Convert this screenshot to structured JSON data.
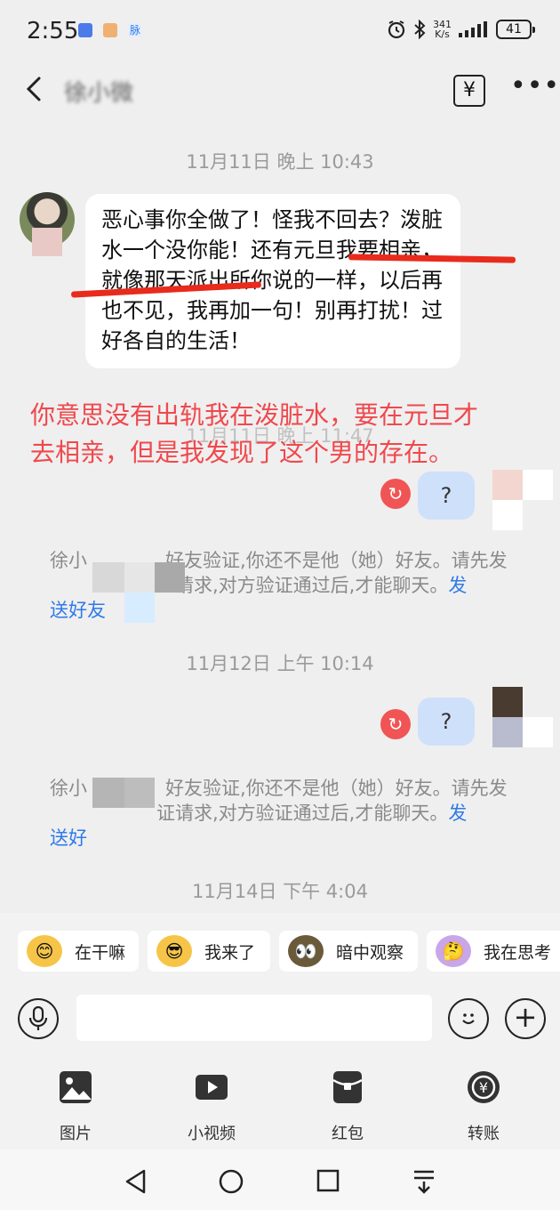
{
  "status_bar": {
    "time": "2:55",
    "net_speed_value": "341",
    "net_speed_unit": "K/s",
    "battery": "41"
  },
  "header": {
    "contact_name": "徐小微",
    "transfer_icon": "yuan-transfer-icon",
    "more_icon": "more-icon"
  },
  "chat": {
    "ts1": "11月11日 晚上 10:43",
    "incoming_message": "恶心事你全做了！怪我不回去？泼脏水一个没你能！还有元旦我要相亲，就像那天派出所你说的一样，以后再也不见，我再加一句！别再打扰！过好各自的生活！",
    "annotation": "你意思没有出轨我在泼脏水，要在元旦才去相亲，但是我发现了这个男的存在。",
    "ts2": "11月11日 晚上 11:47",
    "out1": "?",
    "sys1_prefix": "徐小",
    "sys1_text": "好友验证,你还不是他（她）好友。请先发",
    "sys1_mid": "证请求,对方验证通过后,才能聊天。",
    "sys1_link_a": "发",
    "sys1_link_b": "送好友",
    "ts3": "11月12日 上午 10:14",
    "out2": "?",
    "sys2_prefix": "徐小",
    "sys2_text": "好友验证,你还不是他（她）好友。请先发",
    "sys2_mid": "证请求,对方验证通过后,才能聊天。",
    "sys2_link_a": "发",
    "sys2_link_b": "送好",
    "ts4": "11月14日 下午 4:04"
  },
  "suggestions": [
    {
      "label": "在干嘛",
      "sticker": "在干嘛"
    },
    {
      "label": "我来了",
      "sticker": ""
    },
    {
      "label": "暗中观察",
      "sticker": ""
    },
    {
      "label": "我在思考",
      "sticker": "我在思考"
    }
  ],
  "tools": [
    {
      "label": "图片",
      "icon": "image-icon"
    },
    {
      "label": "小视频",
      "icon": "video-icon"
    },
    {
      "label": "红包",
      "icon": "red-packet-icon"
    },
    {
      "label": "转账",
      "icon": "transfer-icon"
    }
  ],
  "colors": {
    "annotation_red": "#f0484d",
    "link_blue": "#2f7ae8",
    "out_bubble": "#cfe0fb",
    "retry_red": "#f05454"
  }
}
